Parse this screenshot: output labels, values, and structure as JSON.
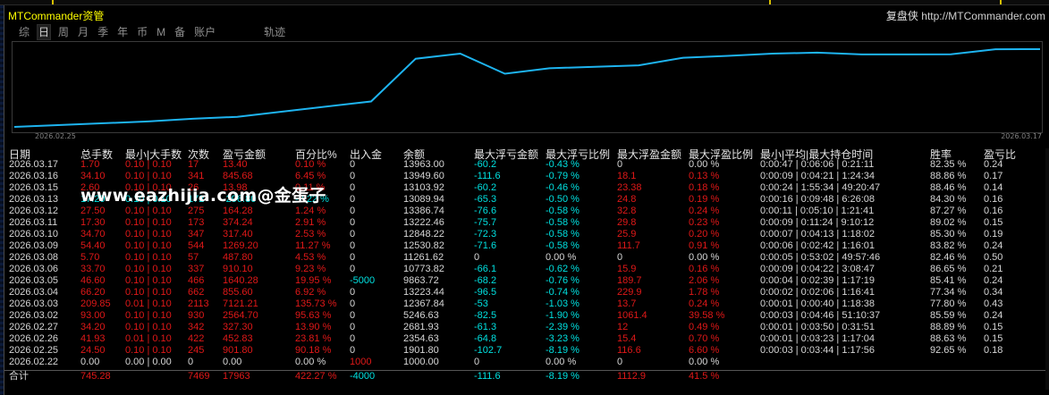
{
  "window": {
    "title": "MTCommander资管",
    "brand_name": "复盘侠",
    "brand_url": "http://MTCommander.com"
  },
  "tabs": [
    {
      "label": "综",
      "active": false
    },
    {
      "label": "日",
      "active": true
    },
    {
      "label": "周",
      "active": false
    },
    {
      "label": "月",
      "active": false
    },
    {
      "label": "季",
      "active": false
    },
    {
      "label": "年",
      "active": false
    },
    {
      "label": "币",
      "active": false
    },
    {
      "label": "M",
      "active": false
    },
    {
      "label": "备",
      "active": false
    },
    {
      "label": "账户",
      "active": false
    },
    {
      "label": "轨迹",
      "active": false
    }
  ],
  "chart_data": {
    "type": "line",
    "x": [
      "2026.02.22",
      "2026.02.25",
      "2026.02.26",
      "2026.02.27",
      "2026.03.02",
      "2026.03.03",
      "2026.03.04",
      "2026.03.05",
      "2026.03.06",
      "2026.03.08",
      "2026.03.09",
      "2026.03.10",
      "2026.03.11",
      "2026.03.12",
      "2026.03.13",
      "2026.03.15",
      "2026.03.16",
      "2026.03.17"
    ],
    "series": [
      {
        "values": [
          1000.0,
          1901.8,
          2354.63,
          2681.93,
          5246.63,
          12367.84,
          13223.44,
          9863.72,
          10773.82,
          11261.62,
          12530.82,
          12848.22,
          13222.46,
          13386.74,
          13089.94,
          13103.92,
          13949.6,
          13963.0
        ]
      }
    ],
    "x_start_label": "2026.02.25",
    "x_end_label": "2026.03.17",
    "line_color": "#1eb4f0"
  },
  "table": {
    "headers": {
      "date": "日期",
      "lots": "总手数",
      "minmax": "最小|大手数",
      "count": "次数",
      "pnl": "盈亏金额",
      "pct": "百分比%",
      "io": "出入金",
      "balance": "余额",
      "max_float_loss": "最大浮亏金额",
      "max_float_loss_pct": "最大浮亏比例",
      "max_float_profit": "最大浮盈金额",
      "max_float_profit_pct": "最大浮盈比例",
      "hold_time": "最小|平均|最大持仓时间",
      "win_rate": "胜率",
      "pl_ratio": "盈亏比"
    },
    "rows": [
      {
        "date": "2026.03.17",
        "lots": "1.70",
        "minmax": "0.10 | 0.10",
        "count": "17",
        "pnl": "13.40",
        "pct": "0.10 %",
        "io": "0",
        "balance": "13963.00",
        "mfl": "-60.2",
        "mflp": "-0.43 %",
        "mfp": "0",
        "mfpp": "0.00 %",
        "time": "0:00:47 | 0:06:06 | 0:21:11",
        "win": "82.35 %",
        "ratio": "0.24",
        "loss": false
      },
      {
        "date": "2026.03.16",
        "lots": "34.10",
        "minmax": "0.10 | 0.10",
        "count": "341",
        "pnl": "845.68",
        "pct": "6.45 %",
        "io": "0",
        "balance": "13949.60",
        "mfl": "-111.6",
        "mflp": "-0.79 %",
        "mfp": "18.1",
        "mfpp": "0.13 %",
        "time": "0:00:09 | 0:04:21 | 1:24:34",
        "win": "88.86 %",
        "ratio": "0.17",
        "loss": false
      },
      {
        "date": "2026.03.15",
        "lots": "2.60",
        "minmax": "0.10 | 0.10",
        "count": "26",
        "pnl": "13.98",
        "pct": "0.11 %",
        "io": "0",
        "balance": "13103.92",
        "mfl": "-60.2",
        "mflp": "-0.46 %",
        "mfp": "23.38",
        "mfpp": "0.18 %",
        "time": "0:00:24 | 1:55:34 | 49:20:47",
        "win": "88.46 %",
        "ratio": "0.14",
        "loss": false
      },
      {
        "date": "2026.03.13",
        "lots": "17.20",
        "minmax": "0.10 | 0.10",
        "count": "172",
        "pnl": "-296.80",
        "pct": "-2.22 %",
        "io": "0",
        "balance": "13089.94",
        "mfl": "-65.3",
        "mflp": "-0.50 %",
        "mfp": "24.8",
        "mfpp": "0.19 %",
        "time": "0:00:16 | 0:09:48 | 6:26:08",
        "win": "84.30 %",
        "ratio": "0.16",
        "loss": true
      },
      {
        "date": "2026.03.12",
        "lots": "27.50",
        "minmax": "0.10 | 0.10",
        "count": "275",
        "pnl": "164.28",
        "pct": "1.24 %",
        "io": "0",
        "balance": "13386.74",
        "mfl": "-76.6",
        "mflp": "-0.58 %",
        "mfp": "32.8",
        "mfpp": "0.24 %",
        "time": "0:00:11 | 0:05:10 | 1:21:41",
        "win": "87.27 %",
        "ratio": "0.16",
        "loss": false
      },
      {
        "date": "2026.03.11",
        "lots": "17.30",
        "minmax": "0.10 | 0.10",
        "count": "173",
        "pnl": "374.24",
        "pct": "2.91 %",
        "io": "0",
        "balance": "13222.46",
        "mfl": "-75.7",
        "mflp": "-0.58 %",
        "mfp": "29.8",
        "mfpp": "0.23 %",
        "time": "0:00:09 | 0:11:24 | 9:10:12",
        "win": "89.02 %",
        "ratio": "0.15",
        "loss": false
      },
      {
        "date": "2026.03.10",
        "lots": "34.70",
        "minmax": "0.10 | 0.10",
        "count": "347",
        "pnl": "317.40",
        "pct": "2.53 %",
        "io": "0",
        "balance": "12848.22",
        "mfl": "-72.3",
        "mflp": "-0.58 %",
        "mfp": "25.9",
        "mfpp": "0.20 %",
        "time": "0:00:07 | 0:04:13 | 1:18:02",
        "win": "85.30 %",
        "ratio": "0.19",
        "loss": false
      },
      {
        "date": "2026.03.09",
        "lots": "54.40",
        "minmax": "0.10 | 0.10",
        "count": "544",
        "pnl": "1269.20",
        "pct": "11.27 %",
        "io": "0",
        "balance": "12530.82",
        "mfl": "-71.6",
        "mflp": "-0.58 %",
        "mfp": "111.7",
        "mfpp": "0.91 %",
        "time": "0:00:06 | 0:02:42 | 1:16:01",
        "win": "83.82 %",
        "ratio": "0.24",
        "loss": false
      },
      {
        "date": "2026.03.08",
        "lots": "5.70",
        "minmax": "0.10 | 0.10",
        "count": "57",
        "pnl": "487.80",
        "pct": "4.53 %",
        "io": "0",
        "balance": "11261.62",
        "mfl": "0",
        "mflp": "0.00 %",
        "mfp": "0",
        "mfpp": "0.00 %",
        "time": "0:00:05 | 0:53:02 | 49:57:46",
        "win": "82.46 %",
        "ratio": "0.50",
        "loss": false
      },
      {
        "date": "2026.03.06",
        "lots": "33.70",
        "minmax": "0.10 | 0.10",
        "count": "337",
        "pnl": "910.10",
        "pct": "9.23 %",
        "io": "0",
        "balance": "10773.82",
        "mfl": "-66.1",
        "mflp": "-0.62 %",
        "mfp": "15.9",
        "mfpp": "0.16 %",
        "time": "0:00:09 | 0:04:22 | 3:08:47",
        "win": "86.65 %",
        "ratio": "0.21",
        "loss": false
      },
      {
        "date": "2026.03.05",
        "lots": "46.60",
        "minmax": "0.10 | 0.10",
        "count": "466",
        "pnl": "1640.28",
        "pct": "19.95 %",
        "io": "-5000",
        "balance": "9863.72",
        "mfl": "-68.2",
        "mflp": "-0.76 %",
        "mfp": "189.7",
        "mfpp": "2.06 %",
        "time": "0:00:04 | 0:02:39 | 1:17:19",
        "win": "85.41 %",
        "ratio": "0.24",
        "loss": false
      },
      {
        "date": "2026.03.04",
        "lots": "66.20",
        "minmax": "0.10 | 0.10",
        "count": "662",
        "pnl": "855.60",
        "pct": "6.92 %",
        "io": "0",
        "balance": "13223.44",
        "mfl": "-96.5",
        "mflp": "-0.74 %",
        "mfp": "229.9",
        "mfpp": "1.78 %",
        "time": "0:00:02 | 0:02:06 | 1:16:41",
        "win": "77.34 %",
        "ratio": "0.34",
        "loss": false
      },
      {
        "date": "2026.03.03",
        "lots": "209.85",
        "minmax": "0.01 | 0.10",
        "count": "2113",
        "pnl": "7121.21",
        "pct": "135.73 %",
        "io": "0",
        "balance": "12367.84",
        "mfl": "-53",
        "mflp": "-1.03 %",
        "mfp": "13.7",
        "mfpp": "0.24 %",
        "time": "0:00:01 | 0:00:40 | 1:18:38",
        "win": "77.80 %",
        "ratio": "0.43",
        "loss": false
      },
      {
        "date": "2026.03.02",
        "lots": "93.00",
        "minmax": "0.10 | 0.10",
        "count": "930",
        "pnl": "2564.70",
        "pct": "95.63 %",
        "io": "0",
        "balance": "5246.63",
        "mfl": "-82.5",
        "mflp": "-1.90 %",
        "mfp": "1061.4",
        "mfpp": "39.58 %",
        "time": "0:00:03 | 0:04:46 | 51:10:37",
        "win": "85.59 %",
        "ratio": "0.24",
        "loss": false
      },
      {
        "date": "2026.02.27",
        "lots": "34.20",
        "minmax": "0.10 | 0.10",
        "count": "342",
        "pnl": "327.30",
        "pct": "13.90 %",
        "io": "0",
        "balance": "2681.93",
        "mfl": "-61.3",
        "mflp": "-2.39 %",
        "mfp": "12",
        "mfpp": "0.49 %",
        "time": "0:00:01 | 0:03:50 | 0:31:51",
        "win": "88.89 %",
        "ratio": "0.15",
        "loss": false
      },
      {
        "date": "2026.02.26",
        "lots": "41.93",
        "minmax": "0.01 | 0.10",
        "count": "422",
        "pnl": "452.83",
        "pct": "23.81 %",
        "io": "0",
        "balance": "2354.63",
        "mfl": "-64.8",
        "mflp": "-3.23 %",
        "mfp": "15.4",
        "mfpp": "0.70 %",
        "time": "0:00:01 | 0:03:23 | 1:17:04",
        "win": "88.63 %",
        "ratio": "0.15",
        "loss": false
      },
      {
        "date": "2026.02.25",
        "lots": "24.50",
        "minmax": "0.10 | 0.10",
        "count": "245",
        "pnl": "901.80",
        "pct": "90.18 %",
        "io": "0",
        "balance": "1901.80",
        "mfl": "-102.7",
        "mflp": "-8.19 %",
        "mfp": "116.6",
        "mfpp": "6.60 %",
        "time": "0:00:03 | 0:03:44 | 1:17:56",
        "win": "92.65 %",
        "ratio": "0.18",
        "loss": false
      },
      {
        "date": "2026.02.22",
        "lots": "0.00",
        "minmax": "0.00 | 0.00",
        "count": "0",
        "pnl": "0.00",
        "pct": "0.00 %",
        "io": "1000",
        "balance": "1000.00",
        "mfl": "0",
        "mflp": "0.00 %",
        "mfp": "0",
        "mfpp": "0.00 %",
        "time": "",
        "win": "",
        "ratio": "",
        "loss": false,
        "opening": true
      }
    ],
    "total": {
      "label": "合计",
      "lots": "745.28",
      "count": "7469",
      "pnl": "17963",
      "pct": "422.27 %",
      "io": "-4000",
      "mfl": "-111.6",
      "mflp": "-8.19 %",
      "mfp": "1112.9",
      "mfpp": "41.5 %"
    }
  },
  "watermark": "www.eazhijia.com@金蛋子"
}
